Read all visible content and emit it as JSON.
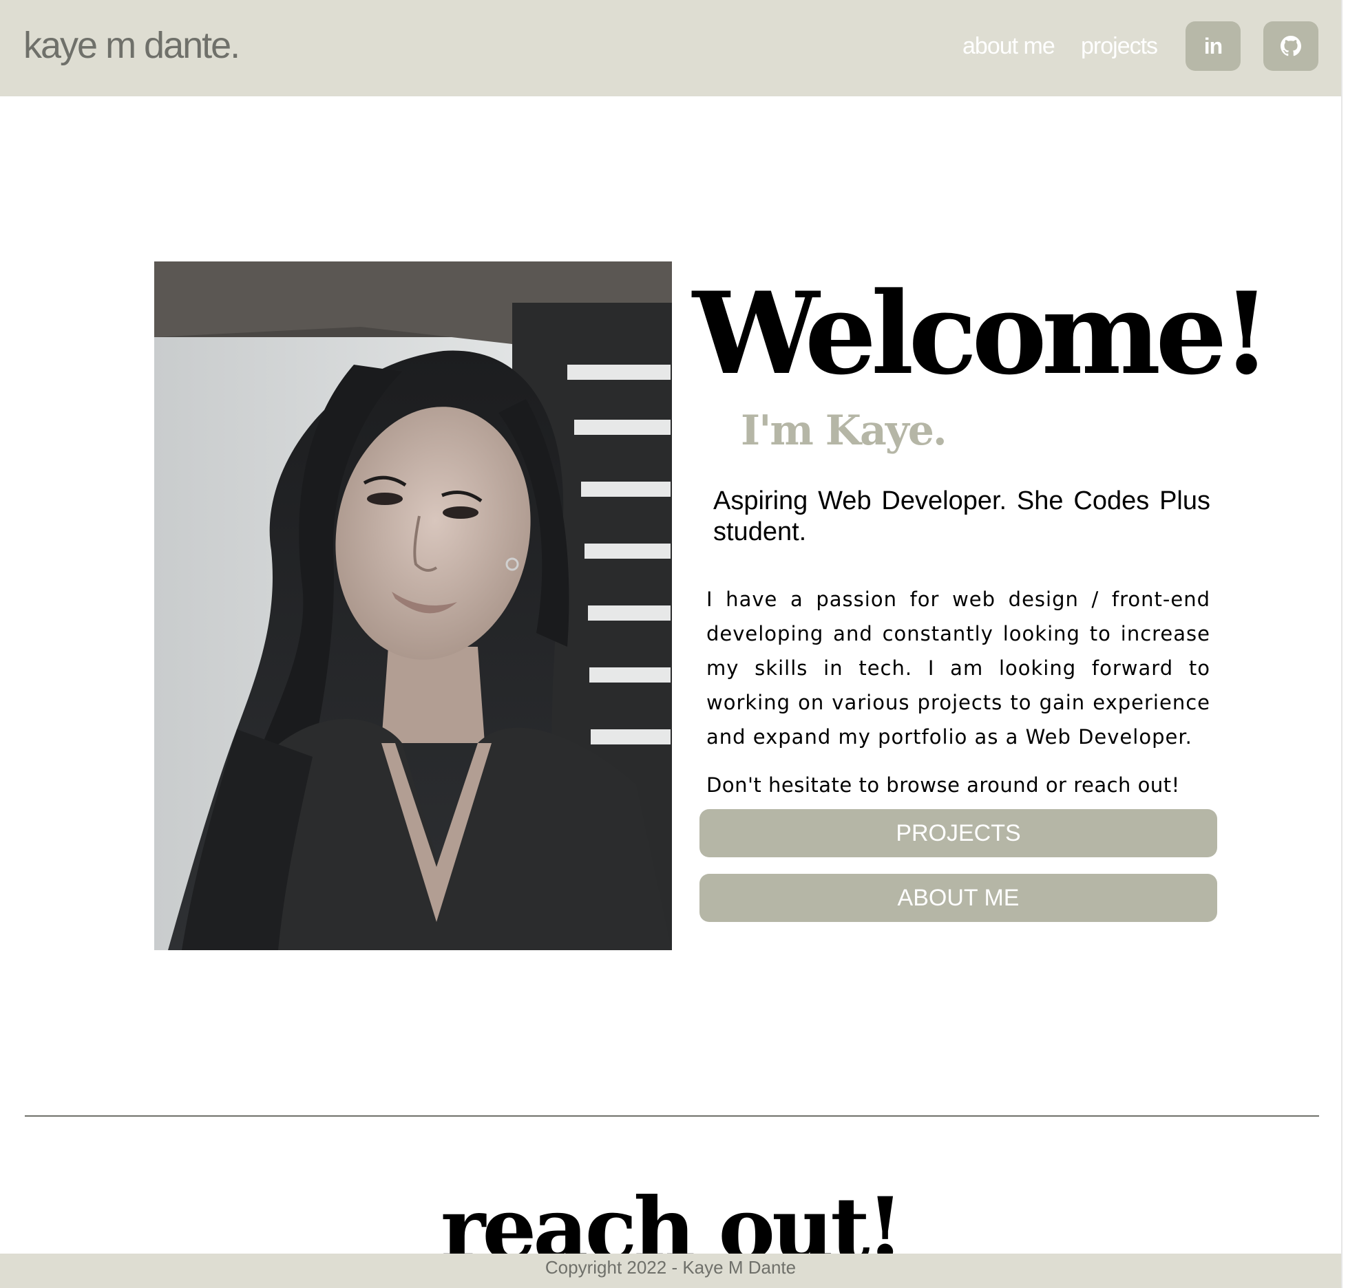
{
  "navbar": {
    "brand": "kaye m dante.",
    "links": [
      "about me",
      "projects"
    ],
    "icons": [
      "linkedin-icon",
      "github-icon"
    ],
    "linkedin_label": "in"
  },
  "hero": {
    "image_alt": "portrait of Kaye",
    "title": "Welcome!",
    "subtitle": "I'm Kaye.",
    "tagline": "Aspiring Web Developer. She Codes Plus student.",
    "bio": "I have a passion for web design / front-end developing and constantly looking to increase my skills in tech. I am looking forward to working on various projects to gain experience and expand my portfolio as a Web Developer.",
    "cta_text": "Don't hesitate to browse around or reach out!",
    "buttons": [
      "PROJECTS",
      "ABOUT ME"
    ]
  },
  "contact": {
    "heading": "reach out!"
  },
  "footer": {
    "copyright": "Copyright 2022 - Kaye M Dante"
  },
  "colors": {
    "nav_background": "#deddd2",
    "accent": "#b5b6a6",
    "brand_text": "#6f706a",
    "text": "#000000"
  }
}
